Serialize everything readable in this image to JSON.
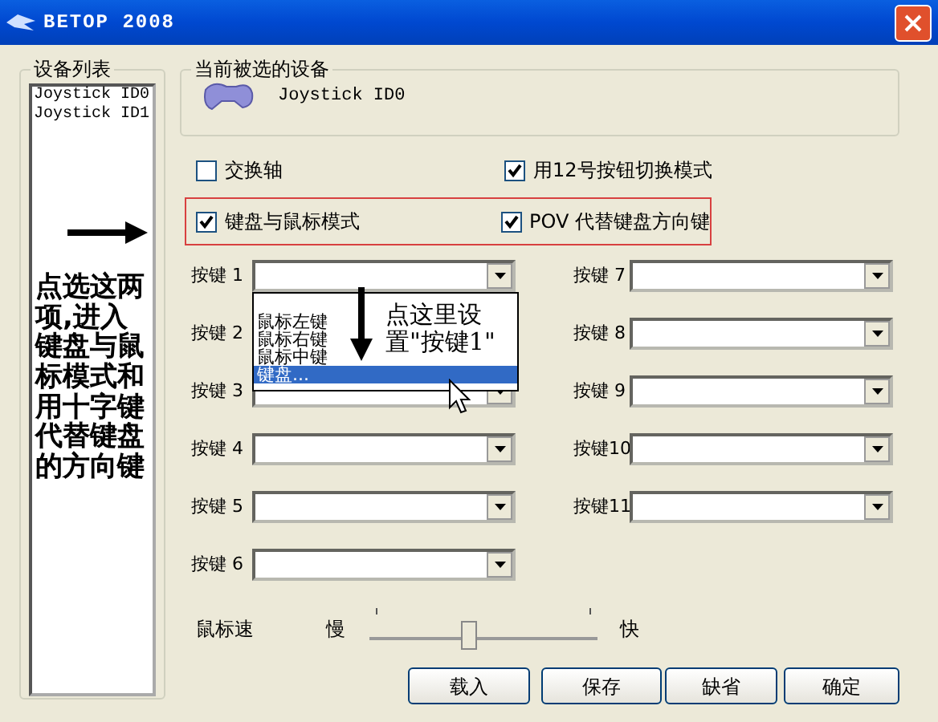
{
  "window": {
    "title": "BETOP 2008"
  },
  "device_list": {
    "label": "设备列表",
    "items": [
      "Joystick ID0",
      "Joystick ID1"
    ]
  },
  "current_device": {
    "label": "当前被选的设备",
    "name": "Joystick ID0"
  },
  "option_rows": [
    {
      "highlighted": false,
      "options": [
        {
          "label": "交换轴",
          "checked": false
        },
        {
          "label": "用12号按钮切换模式",
          "checked": true
        }
      ]
    },
    {
      "highlighted": true,
      "options": [
        {
          "label": "键盘与鼠标模式",
          "checked": true
        },
        {
          "label": "POV 代替键盘方向键",
          "checked": true
        }
      ]
    }
  ],
  "key_columns": [
    [
      {
        "label": "按键 1",
        "open_list": [
          {
            "text": "鼠标左键",
            "selected": false
          },
          {
            "text": "鼠标右键",
            "selected": false
          },
          {
            "text": "鼠标中键",
            "selected": false
          },
          {
            "text": "键盘...",
            "selected": true
          }
        ]
      },
      {
        "label": "按键 2"
      },
      {
        "label": "按键 3"
      },
      {
        "label": "按键 4"
      },
      {
        "label": "按键 5"
      },
      {
        "label": "按键 6"
      }
    ],
    [
      {
        "label": "按键 7"
      },
      {
        "label": "按键 8"
      },
      {
        "label": "按键 9"
      },
      {
        "label": "按键10"
      },
      {
        "label": "按键11"
      }
    ]
  ],
  "mouse_speed": {
    "label": "鼠标速",
    "min_label": "慢",
    "max_label": "快",
    "level": 0.44
  },
  "buttons": [
    "载入",
    "保存",
    "缺省",
    "确定"
  ],
  "annotations": [
    {
      "kind": "side_note",
      "text": "点选这两项,进入键盘与鼠标模式和用十字键代替键盘的方向键"
    },
    {
      "kind": "callout",
      "text": "点这里设置\"按键1\""
    }
  ]
}
